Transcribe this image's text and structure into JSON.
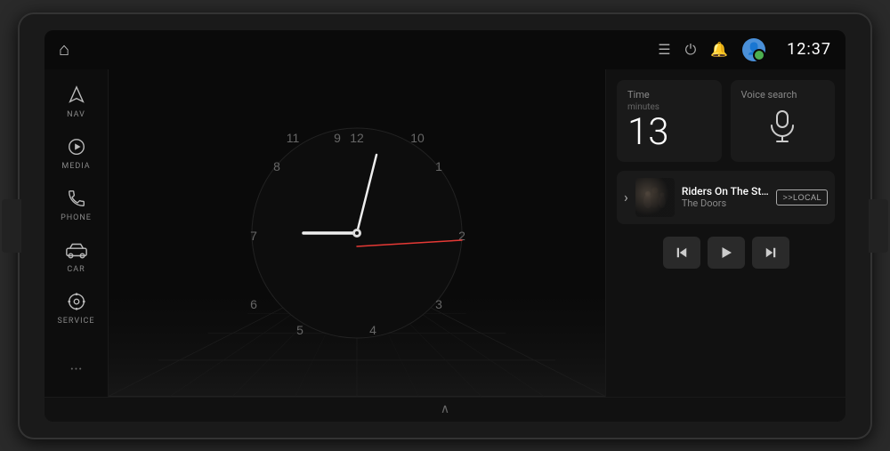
{
  "statusBar": {
    "time": "12:37",
    "homeIcon": "⌂",
    "menuIcon": "☰",
    "powerIcon": "⏻",
    "bellIcon": "🔔",
    "avatarColor": "#4a90d9"
  },
  "sidebar": {
    "items": [
      {
        "id": "nav",
        "icon": "▲",
        "label": "NAV"
      },
      {
        "id": "media",
        "icon": "▶",
        "label": "MEDIA"
      },
      {
        "id": "phone",
        "icon": "📞",
        "label": "PHONE"
      },
      {
        "id": "car",
        "icon": "🚗",
        "label": "CAR"
      },
      {
        "id": "service",
        "icon": "⚙",
        "label": "SERVICE"
      }
    ],
    "moreIcon": "···"
  },
  "clock": {
    "hours": 9,
    "minutes": 13,
    "seconds": 0,
    "hourAngle": 275,
    "minuteAngle": 78,
    "numbers": [
      "12",
      "1",
      "2",
      "3",
      "4",
      "5",
      "6",
      "7",
      "8",
      "9",
      "10",
      "11"
    ]
  },
  "widgets": {
    "time": {
      "label": "Time",
      "sublabel": "minutes",
      "value": "13"
    },
    "voiceSearch": {
      "label": "Voice search"
    }
  },
  "nowPlaying": {
    "title": "Riders On The Storm",
    "artist": "The Doors",
    "localLabel": ">>LOCAL",
    "expandIcon": "›"
  },
  "playback": {
    "prevIcon": "⏮",
    "playIcon": "▶",
    "nextIcon": "⏭"
  },
  "bottomBar": {
    "chevronIcon": "∧"
  }
}
